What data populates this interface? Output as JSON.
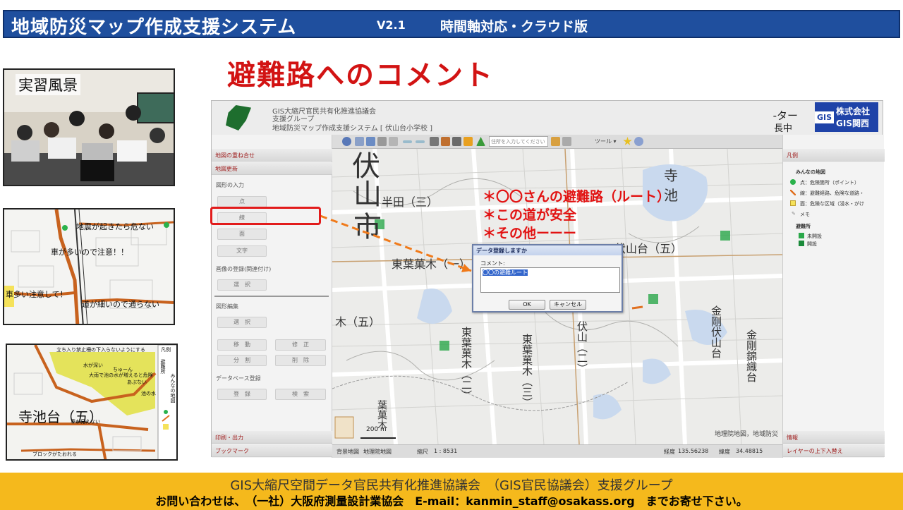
{
  "banner": {
    "title": "地域防災マップ作成支援システム",
    "version": "V2.1",
    "subtitle": "時間軸対応・クラウド版"
  },
  "slide_title": "避難路へのコメント",
  "thumbnails": {
    "photo_label": "実習風景",
    "map2_notes": [
      "地震が起きたら危ない",
      "車が多いので注意！！",
      "車多い注意して！",
      "道が細いので通らない"
    ],
    "map3_label": "寺池台（五）",
    "map3_notes": [
      "立ち入り禁止柵の下入らないようにする",
      "水が深い",
      "ちゅーん",
      "大雨で池の水が増えると危険",
      "あぶない",
      "池の水",
      "車が見えない",
      "ブロックがたおれる",
      "凡例",
      "避難所",
      "みんなの地図"
    ]
  },
  "app": {
    "header_line1": "GIS大縮尺官民共有化推進協議会",
    "header_line2": "支援グループ",
    "header_line3": "地域防災マップ作成支援システム [ 伏山台小学校 ]",
    "header_right1": "-ター",
    "header_right2": "長中",
    "company_mark": "GIS",
    "company_name": "株式会社GIS関西",
    "toolbar": {
      "search_placeholder": "住所を入力してください",
      "tool_menu": "ツール ▾"
    },
    "left_panel": {
      "sec_overlay": "地図の重ね合せ",
      "sec_update": "地図更新",
      "label_input": "図形の入力",
      "btn_point": "点",
      "btn_line": "線",
      "btn_area": "面",
      "btn_text": "文字",
      "label_image": "画像の登録(関連付け)",
      "btn_select1": "選　択",
      "label_edit": "図形編集",
      "btn_select2": "選　択",
      "btn_move": "移　動",
      "btn_modify": "修　正",
      "btn_split": "分　割",
      "btn_delete": "削　除",
      "label_db": "データベース登録",
      "btn_register": "登　録",
      "btn_search": "検　索",
      "sec_print": "印刷・出力",
      "sec_bookmark": "ブックマーク"
    },
    "map": {
      "labels": [
        "伏",
        "山",
        "市",
        "半田（三）",
        "東葉菓木（一）",
        "寺",
        "池",
        "伏山台（五）",
        "東葉菓木（二）",
        "東葉菓木（三）",
        "伏山（二）",
        "金剛伏山台",
        "金剛錦織台",
        "木（五）",
        "葉菓木"
      ],
      "scale": "200 m",
      "attribution": "地理院地図，地域防災"
    },
    "status": {
      "bg_label": "背景地図",
      "bg_value": "地理院地図",
      "scale_label": "縮尺",
      "scale_value": "1 : 8531",
      "lon_label": "経度",
      "lon_value": "135.56238",
      "lat_label": "緯度",
      "lat_value": "34.48815"
    },
    "right_panel": {
      "sec_legend": "凡例",
      "group_map": "みんなの地図",
      "item_point": "点：危険箇所（ポイント）",
      "item_line": "線：避難経路、危険な道路・",
      "item_area": "面：危険な区域（浸水・がけ",
      "item_memo": "メモ",
      "group_shelter": "避難所",
      "shelter_closed": "未開設",
      "shelter_open": "開設",
      "sec_info": "情報",
      "sec_layer": "レイヤーの上下入替え"
    },
    "dialog": {
      "title": "データ登録しますか",
      "label": "コメント:",
      "text": "〇〇の避難ルート",
      "ok": "OK",
      "cancel": "キャンセル"
    }
  },
  "annotations": [
    "＊〇〇さんの避難路（ルート）",
    "＊この道が安全",
    "＊その他ーーー"
  ],
  "footer": {
    "line1": "GIS大縮尺空間データ官民共有化推進協議会　（GIS官民協議会）支援グループ",
    "line2": "お問い合わせは、　（一社）大阪府測量設計業協会　E-mail：kanmin_staff@osakass.org　までお寄せ下さい。"
  },
  "colors": {
    "banner": "#1f4f9e",
    "title_red": "#d21313",
    "footer": "#f5b91c",
    "route_orange": "#e07020"
  }
}
